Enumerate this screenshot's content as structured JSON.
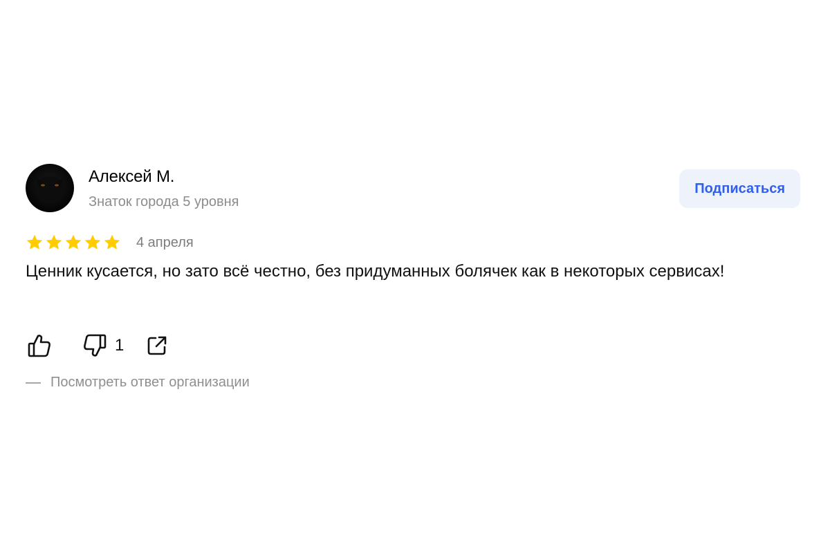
{
  "review": {
    "author": {
      "name": "Алексей М.",
      "level": "Знаток города 5 уровня",
      "avatar_icon": "avatar-black-cat"
    },
    "subscribe_label": "Подписаться",
    "rating": 5,
    "rating_max": 5,
    "date": "4 апреля",
    "text": "Ценник кусается, но зато всё честно, без придуманных болячек как в некоторых сервисах!",
    "actions": {
      "like_icon": "thumbs-up-icon",
      "dislike_icon": "thumbs-down-icon",
      "dislike_count": "1",
      "share_icon": "share-icon"
    },
    "org_reply_label": "Посмотреть ответ организации"
  },
  "colors": {
    "accent": "#2e5ff2",
    "button_bg": "#eef2fb",
    "star": "#ffcc00",
    "muted_text": "#8c8c8c"
  }
}
